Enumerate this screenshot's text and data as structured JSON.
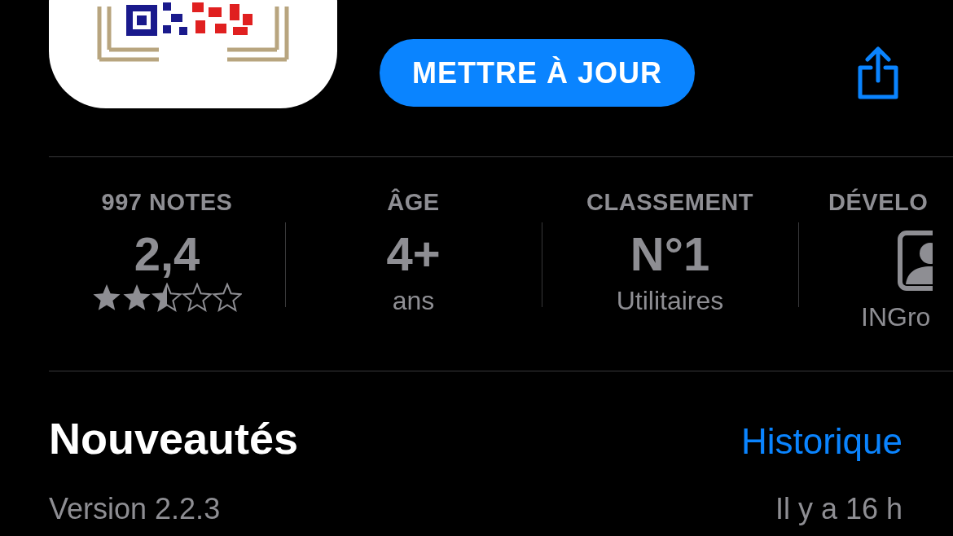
{
  "app": {
    "update_button": "METTRE À JOUR"
  },
  "info": [
    {
      "kind": "rating",
      "label": "997 NOTES",
      "value": "2,4",
      "stars": 2.5
    },
    {
      "kind": "text",
      "label": "ÂGE",
      "value": "4+",
      "caption": "ans"
    },
    {
      "kind": "text",
      "label": "CLASSEMENT",
      "value": "N°1",
      "caption": "Utilitaires"
    },
    {
      "kind": "developer",
      "label": "DÉVELO",
      "caption": "INGro"
    }
  ],
  "whats_new": {
    "title": "Nouveautés",
    "link": "Historique",
    "version": "Version 2.2.3",
    "time": "Il y a 16 h"
  }
}
